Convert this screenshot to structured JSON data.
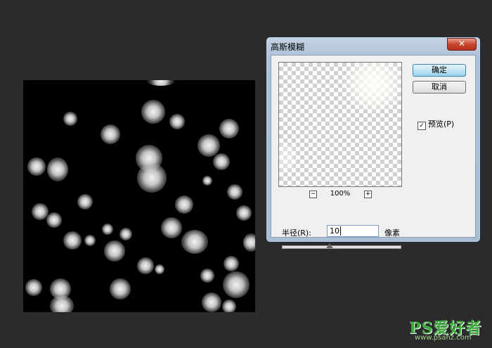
{
  "dialog": {
    "title": "高斯模糊",
    "close_label": "✕",
    "ok_label": "确定",
    "cancel_label": "取消",
    "preview_label": "预览(P)",
    "preview_checked": true,
    "zoom_out": "−",
    "zoom_in": "+",
    "zoom_level": "100%",
    "radius_label": "半径(R):",
    "radius_value": "10",
    "radius_unit": "像素",
    "slider_value_fraction": 0.4
  },
  "watermark": {
    "logo": "PS爱好者",
    "url": "www.psahz.com"
  },
  "colors": {
    "workspace": "#2b2b2b",
    "canvas": "#000000",
    "dialog_frame": "#adc1d8",
    "primary_button": "#98d1ef",
    "close_button": "#c9452d",
    "watermark_green": "#3fa93f"
  }
}
